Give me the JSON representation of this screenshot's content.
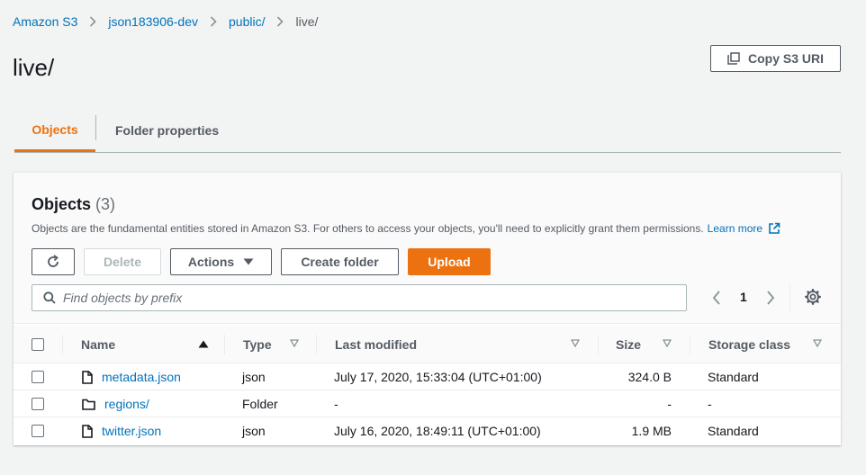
{
  "breadcrumb": {
    "items": [
      "Amazon S3",
      "json183906-dev",
      "public/"
    ],
    "current": "live/"
  },
  "page": {
    "title": "live/",
    "copy_uri_label": "Copy S3 URI"
  },
  "tabs": [
    {
      "label": "Objects",
      "active": true
    },
    {
      "label": "Folder properties",
      "active": false
    }
  ],
  "objects_panel": {
    "title": "Objects",
    "count": "(3)",
    "description": "Objects are the fundamental entities stored in Amazon S3. For others to access your objects, you'll need to explicitly grant them permissions.",
    "learn_more": "Learn more"
  },
  "toolbar": {
    "delete_label": "Delete",
    "actions_label": "Actions",
    "create_folder_label": "Create folder",
    "upload_label": "Upload"
  },
  "search": {
    "placeholder": "Find objects by prefix",
    "value": ""
  },
  "pagination": {
    "page": "1"
  },
  "table": {
    "columns": [
      "Name",
      "Type",
      "Last modified",
      "Size",
      "Storage class"
    ],
    "rows": [
      {
        "name": "metadata.json",
        "icon": "file-icon",
        "type": "json",
        "last_modified": "July 17, 2020, 15:33:04 (UTC+01:00)",
        "size": "324.0 B",
        "storage_class": "Standard"
      },
      {
        "name": "regions/",
        "icon": "folder-icon",
        "type": "Folder",
        "last_modified": "-",
        "size": "-",
        "storage_class": "-"
      },
      {
        "name": "twitter.json",
        "icon": "file-icon",
        "type": "json",
        "last_modified": "July 16, 2020, 18:49:11 (UTC+01:00)",
        "size": "1.9 MB",
        "storage_class": "Standard"
      }
    ]
  },
  "colors": {
    "accent": "#ec7211",
    "link": "#0073bb",
    "text": "#16191f",
    "muted": "#545b64",
    "background": "#f2f3f3"
  }
}
